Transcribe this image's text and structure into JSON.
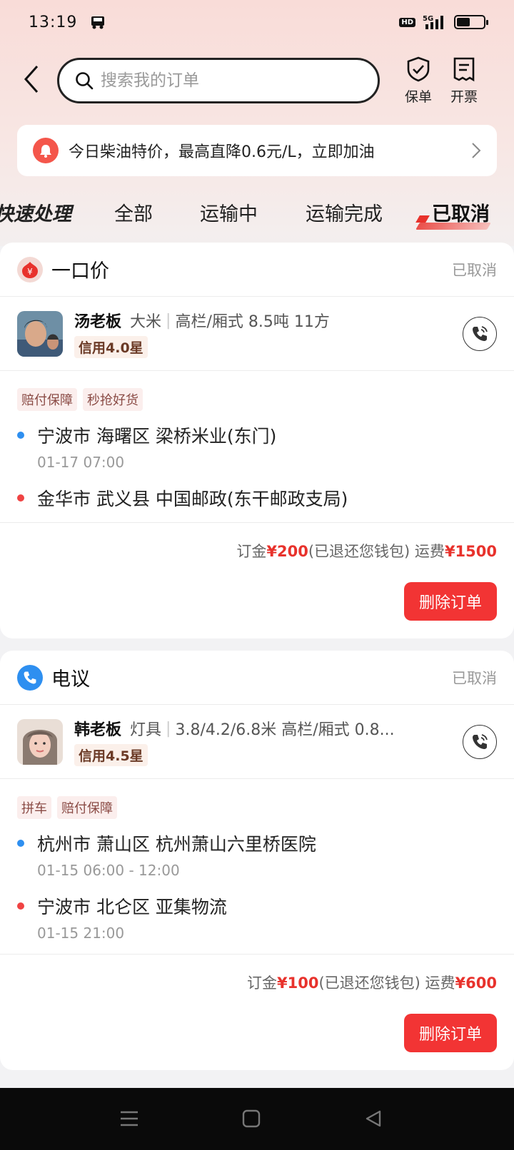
{
  "status_bar": {
    "time": "13:19",
    "hd": "HD",
    "network": "5G",
    "battery_level": 0.5
  },
  "header": {
    "search_placeholder": "搜索我的订单",
    "actions": [
      {
        "label": "保单",
        "icon": "shield-check-icon"
      },
      {
        "label": "开票",
        "icon": "invoice-icon"
      }
    ]
  },
  "promo": {
    "text": "今日柴油特价，最高直降0.6元/L，立即加油"
  },
  "tabs": [
    {
      "label": "快速处理"
    },
    {
      "label": "全部"
    },
    {
      "label": "运输中"
    },
    {
      "label": "运输完成"
    },
    {
      "label": "已取消",
      "active": true
    }
  ],
  "orders": [
    {
      "type": "一口价",
      "status": "已取消",
      "shipper": {
        "name": "汤老板",
        "cargo": "大米",
        "spec": "高栏/厢式 8.5吨 11方",
        "credit": "信用4.0星"
      },
      "tags": [
        "赔付保障",
        "秒抢好货"
      ],
      "from": {
        "address": "宁波市 海曙区 梁桥米业(东门)",
        "time": "01-17 07:00"
      },
      "to": {
        "address": "金华市 武义县 中国邮政(东干邮政支局)",
        "time": ""
      },
      "fee": {
        "deposit_label": "订金",
        "deposit": "¥200",
        "deposit_note": "(已退还您钱包)",
        "freight_label": " 运费",
        "freight": "¥1500"
      },
      "action": "删除订单"
    },
    {
      "type": "电议",
      "status": "已取消",
      "shipper": {
        "name": "韩老板",
        "cargo": "灯具",
        "spec": "3.8/4.2/6.8米 高栏/厢式 0.8...",
        "credit": "信用4.5星"
      },
      "tags": [
        "拼车",
        "赔付保障"
      ],
      "from": {
        "address": "杭州市 萧山区 杭州萧山六里桥医院",
        "time": "01-15 06:00 - 12:00"
      },
      "to": {
        "address": "宁波市 北仑区 亚集物流",
        "time": "01-15 21:00"
      },
      "fee": {
        "deposit_label": "订金",
        "deposit": "¥100",
        "deposit_note": "(已退还您钱包)",
        "freight_label": " 运费",
        "freight": "¥600"
      },
      "action": "删除订单"
    }
  ],
  "colors": {
    "accent": "#e8322c",
    "button": "#f23434",
    "origin_dot": "#2e8ff0",
    "dest_dot": "#f04343"
  }
}
